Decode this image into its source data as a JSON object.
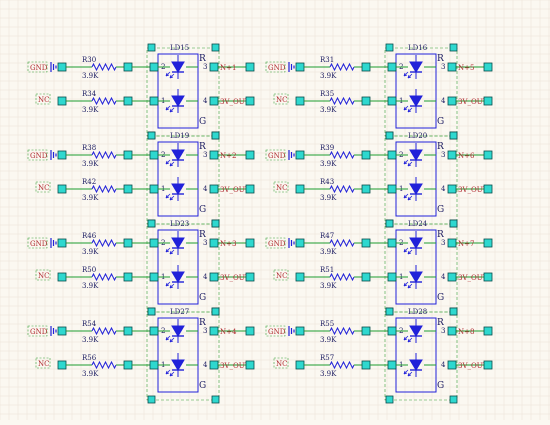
{
  "colors": {
    "background": "#fbf8f1",
    "grid": "#ebe2d6",
    "wire": "#1d9b2e",
    "pad": "#2ed8cf",
    "pad_stroke": "#0a4c4a",
    "part_line": "#2121d9",
    "label_dark": "#1a1a60",
    "net_label": "#b02a30",
    "select_box": "#3aa03a"
  },
  "icons": {
    "led": "led-triangle-icon",
    "resistor": "resistor-zigzag-icon",
    "ground": "ground-symbol-icon",
    "pad": "square-pad-icon"
  },
  "blocks": [
    {
      "led": "LD15",
      "r_top": "R30",
      "r_bot": "R34",
      "r_top_val": "3.9K",
      "r_bot_val": "3.9K",
      "net_left_top": "GND",
      "net_left_bot": "NC",
      "net_right_top": "N+1",
      "net_right_bot": "3V_OUT",
      "pin_left_top": "2",
      "pin_left_bot": "1",
      "pin_right_top": "3",
      "pin_right_bot": "4",
      "pin_r": "R",
      "pin_g": "G"
    },
    {
      "led": "LD16",
      "r_top": "R31",
      "r_bot": "R35",
      "r_top_val": "3.9K",
      "r_bot_val": "3.9K",
      "net_left_top": "GND",
      "net_left_bot": "NC",
      "net_right_top": "N+5",
      "net_right_bot": "3V_OUT",
      "pin_left_top": "2",
      "pin_left_bot": "1",
      "pin_right_top": "3",
      "pin_right_bot": "4",
      "pin_r": "R",
      "pin_g": "G"
    },
    {
      "led": "LD19",
      "r_top": "R38",
      "r_bot": "R42",
      "r_top_val": "3.9K",
      "r_bot_val": "3.9K",
      "net_left_top": "GND",
      "net_left_bot": "NC",
      "net_right_top": "N+2",
      "net_right_bot": "3V_OUT",
      "pin_left_top": "2",
      "pin_left_bot": "1",
      "pin_right_top": "3",
      "pin_right_bot": "4",
      "pin_r": "R",
      "pin_g": "G"
    },
    {
      "led": "LD20",
      "r_top": "R39",
      "r_bot": "R43",
      "r_top_val": "3.9K",
      "r_bot_val": "3.9K",
      "net_left_top": "GND",
      "net_left_bot": "NC",
      "net_right_top": "N+6",
      "net_right_bot": "3V_OUT",
      "pin_left_top": "2",
      "pin_left_bot": "1",
      "pin_right_top": "3",
      "pin_right_bot": "4",
      "pin_r": "R",
      "pin_g": "G"
    },
    {
      "led": "LD23",
      "r_top": "R46",
      "r_bot": "R50",
      "r_top_val": "3.9K",
      "r_bot_val": "3.9K",
      "net_left_top": "GND",
      "net_left_bot": "NC",
      "net_right_top": "N+3",
      "net_right_bot": "3V_OUT",
      "pin_left_top": "2",
      "pin_left_bot": "1",
      "pin_right_top": "3",
      "pin_right_bot": "4",
      "pin_r": "R",
      "pin_g": "G"
    },
    {
      "led": "LD24",
      "r_top": "R47",
      "r_bot": "R51",
      "r_top_val": "3.9K",
      "r_bot_val": "3.9K",
      "net_left_top": "GND",
      "net_left_bot": "NC",
      "net_right_top": "N+7",
      "net_right_bot": "3V_OUT",
      "pin_left_top": "2",
      "pin_left_bot": "1",
      "pin_right_top": "3",
      "pin_right_bot": "4",
      "pin_r": "R",
      "pin_g": "G"
    },
    {
      "led": "LD27",
      "r_top": "R54",
      "r_bot": "R56",
      "r_top_val": "3.9K",
      "r_bot_val": "3.9K",
      "net_left_top": "GND",
      "net_left_bot": "NC",
      "net_right_top": "N+4",
      "net_right_bot": "3V_OUT",
      "pin_left_top": "2",
      "pin_left_bot": "1",
      "pin_right_top": "3",
      "pin_right_bot": "4",
      "pin_r": "R",
      "pin_g": "G"
    },
    {
      "led": "LD28",
      "r_top": "R55",
      "r_bot": "R57",
      "r_top_val": "3.9K",
      "r_bot_val": "3.9K",
      "net_left_top": "GND",
      "net_left_bot": "NC",
      "net_right_top": "N+8",
      "net_right_bot": "3V_OUT",
      "pin_left_top": "2",
      "pin_left_bot": "1",
      "pin_right_top": "3",
      "pin_right_bot": "4",
      "pin_r": "R",
      "pin_g": "G"
    }
  ]
}
